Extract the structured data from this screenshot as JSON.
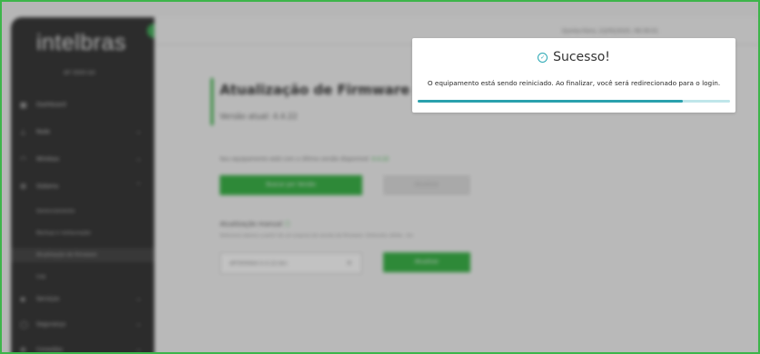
{
  "app": {
    "logo": "intelbras",
    "model": "AP 3000 AX",
    "datetime": "Quinta-Feira, 22/05/2025, 08:39:01"
  },
  "sidebar": {
    "items": [
      {
        "label": "Dashboard",
        "icon": "grid-icon",
        "chevron": ""
      },
      {
        "label": "Rede",
        "icon": "network-icon",
        "chevron": "⌄"
      },
      {
        "label": "Wireless",
        "icon": "wifi-icon",
        "chevron": "⌄"
      },
      {
        "label": "Sistema",
        "icon": "gear-icon",
        "chevron": "⌃"
      }
    ],
    "subitems": [
      {
        "label": "Gerenciamento"
      },
      {
        "label": "Backup e restauração"
      },
      {
        "label": "Atualização de firmware"
      },
      {
        "label": "Log"
      }
    ],
    "items_after": [
      {
        "label": "Serviços",
        "icon": "services-icon",
        "chevron": "⌄"
      },
      {
        "label": "Segurança",
        "icon": "shield-icon",
        "chevron": "⌄"
      },
      {
        "label": "Conexões",
        "icon": "link-icon",
        "chevron": "⌄"
      }
    ]
  },
  "main": {
    "title": "Atualização de Firmware",
    "version": "Versão atual: 4.4.22",
    "notice": "Seu equipamento está com a última versão disponível:",
    "notice_version": "4.4.22",
    "check_button": "Buscar por Versão",
    "update_disabled_button": "Atualizar",
    "manual_label": "Atualização manual",
    "manual_desc": "Selecione abaixo a partir de um arquivo de versão de firmware. Extensão válida: .bin",
    "file_name": "AP3000AX-4.4.22.bin",
    "update_button": "Atualizar"
  },
  "modal": {
    "title": "Sucesso!",
    "message": "O equipamento está sendo reiniciado. Ao finalizar, você será redirecionado para o login.",
    "progress": 0.85
  },
  "colors": {
    "brand_green": "#3db54a",
    "progress_teal": "#2aa1ad",
    "sidebar_bg": "#3a3a3a"
  }
}
